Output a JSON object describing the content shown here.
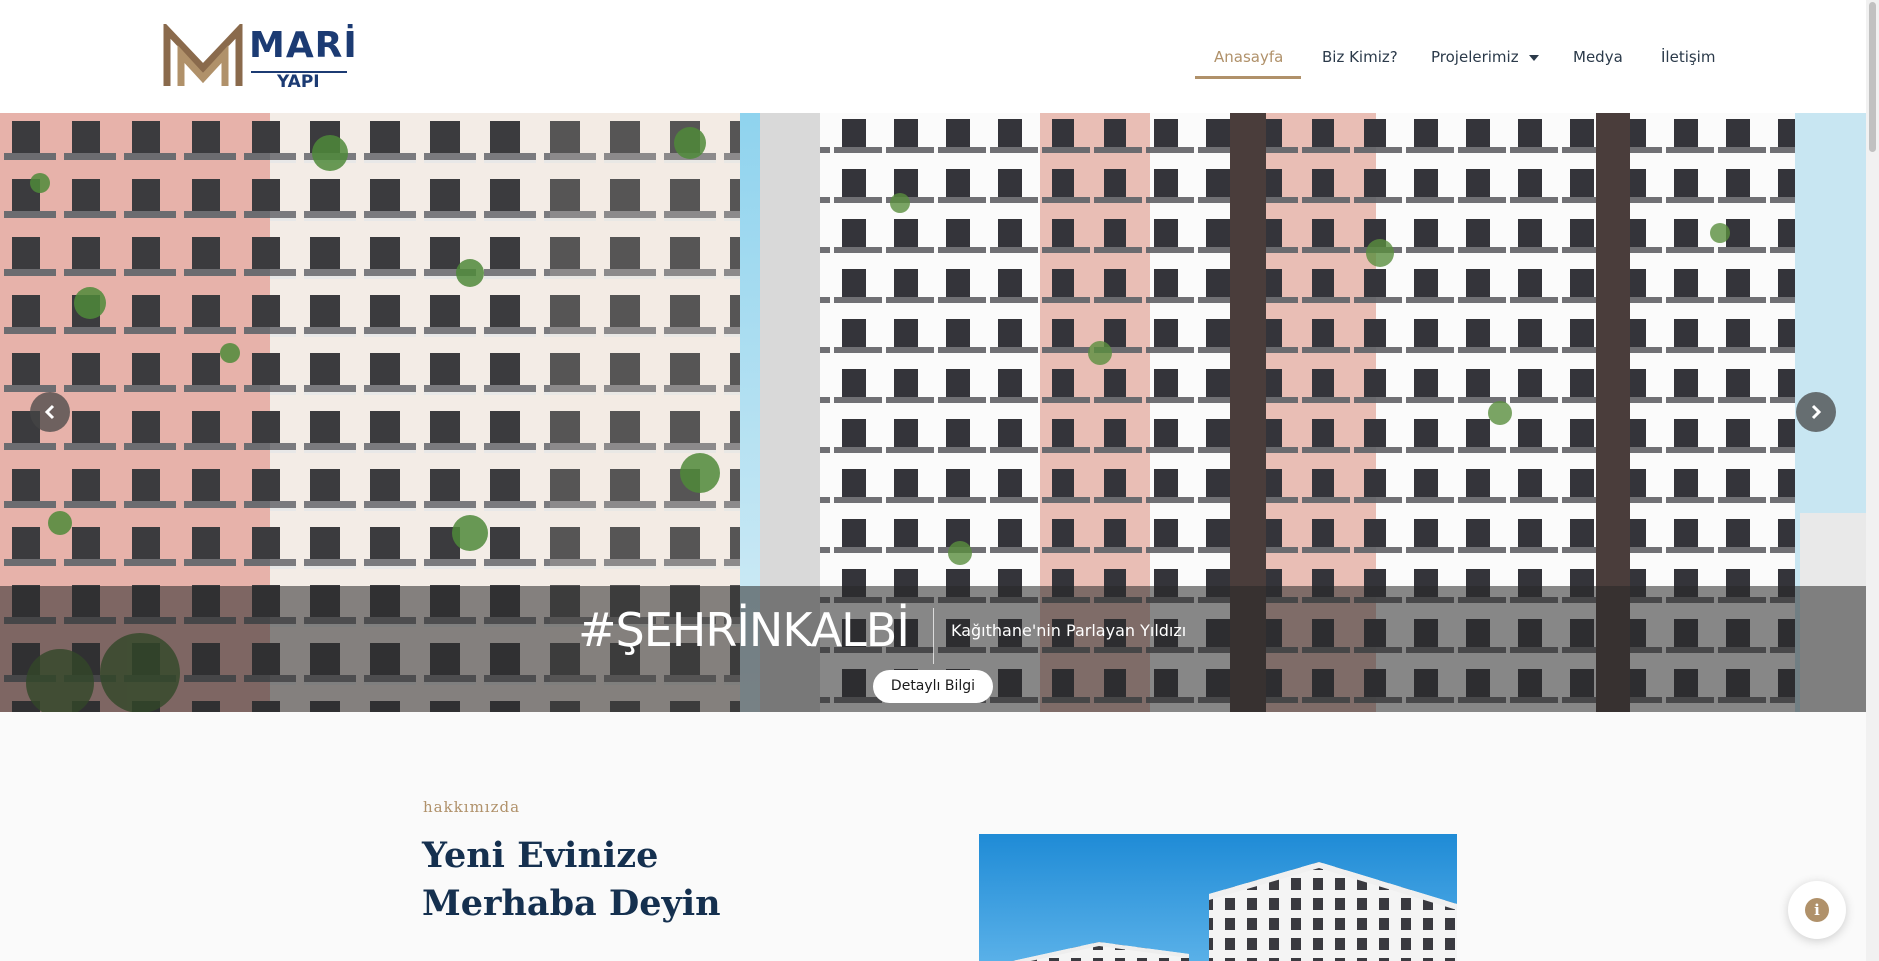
{
  "brand": {
    "name": "MARİ",
    "sub": "YAPI",
    "colors": {
      "accent": "#b0916a",
      "navy": "#1c3b73",
      "heading": "#15304f"
    }
  },
  "nav": {
    "items": [
      {
        "label": "Anasayfa",
        "active": true
      },
      {
        "label": "Biz Kimiz?",
        "active": false
      },
      {
        "label": "Projelerimiz",
        "active": false,
        "has_dropdown": true
      },
      {
        "label": "Medya",
        "active": false
      },
      {
        "label": "İletişim",
        "active": false
      }
    ]
  },
  "slider": {
    "title": "#ŞEHRİNKALBİ",
    "subtitle": "Kağıthane'nin Parlayan Yıldızı",
    "button_label": "Detaylı Bilgi",
    "prev_icon": "chevron-left-icon",
    "next_icon": "chevron-right-icon"
  },
  "about": {
    "eyebrow": "hakkımızda",
    "title": "Yeni Evinize Merhaba Deyin"
  },
  "fab": {
    "icon": "info-icon",
    "glyph": "i"
  }
}
